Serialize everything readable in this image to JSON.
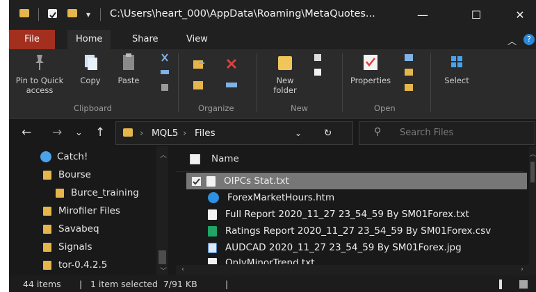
{
  "window": {
    "title": "C:\\Users\\heart_000\\AppData\\Roaming\\MetaQuotes...",
    "minimize": "—",
    "maximize": "☐",
    "close": "✕"
  },
  "tabs": [
    {
      "label": "File",
      "active": false,
      "accent": "#a3301f"
    },
    {
      "label": "Home",
      "active": true
    },
    {
      "label": "Share",
      "active": false
    },
    {
      "label": "View",
      "active": false
    }
  ],
  "ribbon": {
    "pin": "Pin to Quick\naccess",
    "copy": "Copy",
    "paste": "Paste",
    "new_folder": "New\nfolder",
    "properties": "Properties",
    "select": "Select",
    "groups": {
      "clipboard": "Clipboard",
      "organize": "Organize",
      "new": "New",
      "open": "Open"
    }
  },
  "address": {
    "crumb_sep": "›",
    "crumbs": [
      "MQL5",
      "Files"
    ],
    "search_placeholder": "Search Files"
  },
  "navpane": {
    "items": [
      {
        "label": "Catch!",
        "icon": "onedrive-icon"
      },
      {
        "label": "Bourse",
        "icon": "folder-icon"
      },
      {
        "label": "Burce_training",
        "icon": "folder-icon"
      },
      {
        "label": "Mirofiler Files",
        "icon": "folder-icon"
      },
      {
        "label": "Savabeq",
        "icon": "folder-icon"
      },
      {
        "label": "Signals",
        "icon": "folder-icon"
      },
      {
        "label": "tor-0.4.2.5",
        "icon": "folder-icon"
      }
    ]
  },
  "filelist": {
    "column_name": "Name",
    "files": [
      {
        "name": "OIPCs Stat.txt",
        "icon": "text-file-icon",
        "selected": true
      },
      {
        "name": "ForexMarketHours.htm",
        "icon": "edge-icon",
        "selected": false
      },
      {
        "name": "Full Report 2020_11_27 23_54_59 By SM01Forex.txt",
        "icon": "text-file-icon",
        "selected": false
      },
      {
        "name": "Ratings Report 2020_11_27 23_54_59 By SM01Forex.csv",
        "icon": "excel-file-icon",
        "selected": false
      },
      {
        "name": "AUDCAD 2020_11_27 23_54_59 By SM01Forex.jpg",
        "icon": "image-file-icon",
        "selected": false
      },
      {
        "name": "OnlyMinorTrend.txt",
        "icon": "text-file-icon",
        "selected": false
      }
    ]
  },
  "status": {
    "items": "44 items",
    "selected": "1 item selected  7/91 KB",
    "sep": "|"
  }
}
